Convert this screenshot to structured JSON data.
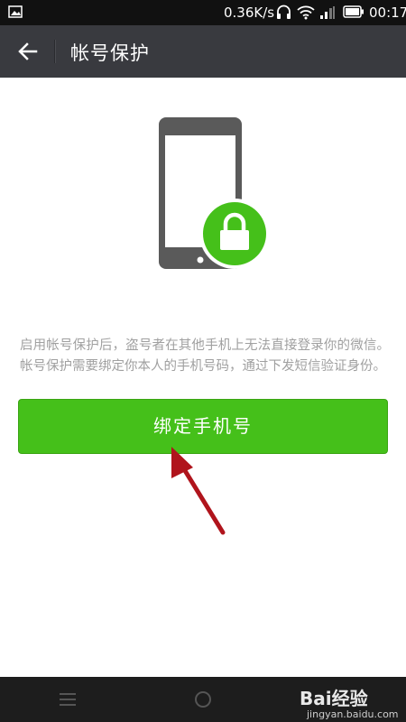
{
  "status_bar": {
    "net_speed": "0.36K/s",
    "time": "00:17"
  },
  "title_bar": {
    "title": "帐号保护"
  },
  "content": {
    "description": "启用帐号保护后，盗号者在其他手机上无法直接登录你的微信。帐号保护需要绑定你本人的手机号码，通过下发短信验证身份。",
    "bind_button_label": "绑定手机号"
  },
  "watermark": {
    "logo": "Bai经验",
    "url": "jingyan.baidu.com"
  },
  "colors": {
    "primary_green": "#45c01a",
    "title_bar_bg": "#393a3f",
    "annotation_arrow": "#b0141c"
  },
  "icons": [
    "gallery-icon",
    "headphone-icon",
    "wifi-icon",
    "signal-icon",
    "battery-icon",
    "back-arrow-icon",
    "lock-icon",
    "menu-icon",
    "home-circle-icon"
  ]
}
